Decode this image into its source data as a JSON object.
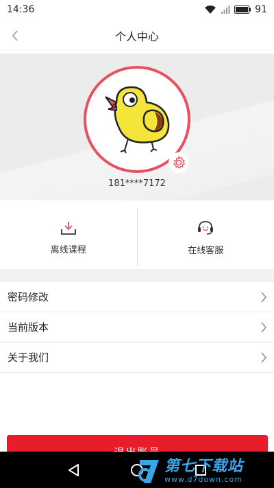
{
  "status_bar": {
    "time": "14:36",
    "battery": "91"
  },
  "header": {
    "title": "个人中心"
  },
  "profile": {
    "phone": "181****7172"
  },
  "quick_actions": [
    {
      "label": "离线课程",
      "icon": "download-icon"
    },
    {
      "label": "在线客服",
      "icon": "headset-icon"
    }
  ],
  "menu": {
    "items": [
      {
        "label": "密码修改"
      },
      {
        "label": "当前版本"
      },
      {
        "label": "关于我们"
      }
    ]
  },
  "logout": {
    "label": "退出账号"
  },
  "watermark": {
    "title": "第七下载站",
    "url": "www.d7down.com"
  },
  "colors": {
    "accent_red": "#e81d2b",
    "avatar_ring": "#e8505f",
    "watermark_blue": "#3aa6e8"
  }
}
